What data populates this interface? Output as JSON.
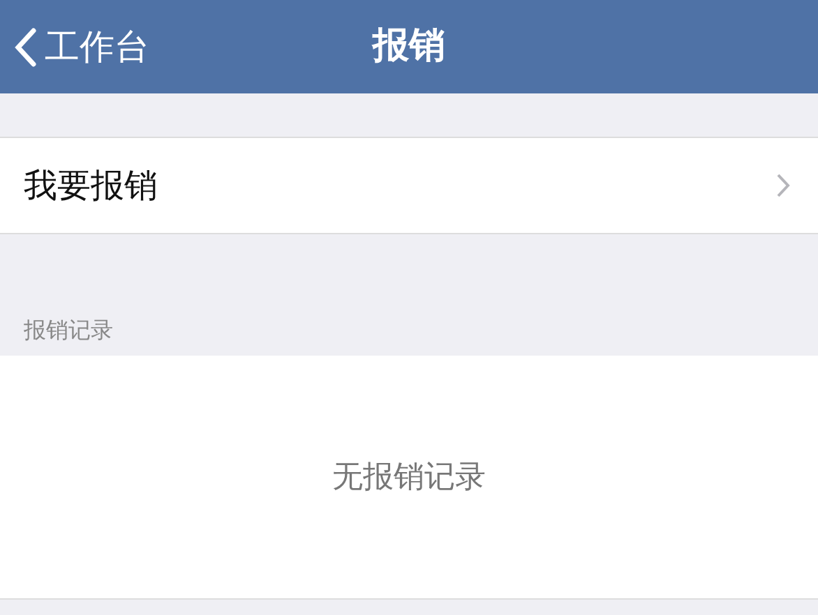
{
  "nav_bar": {
    "back_label": "工作台",
    "title": "报销"
  },
  "menu_items": [
    {
      "label": "我要报销"
    }
  ],
  "section": {
    "title": "报销记录",
    "empty_text": "无报销记录"
  }
}
